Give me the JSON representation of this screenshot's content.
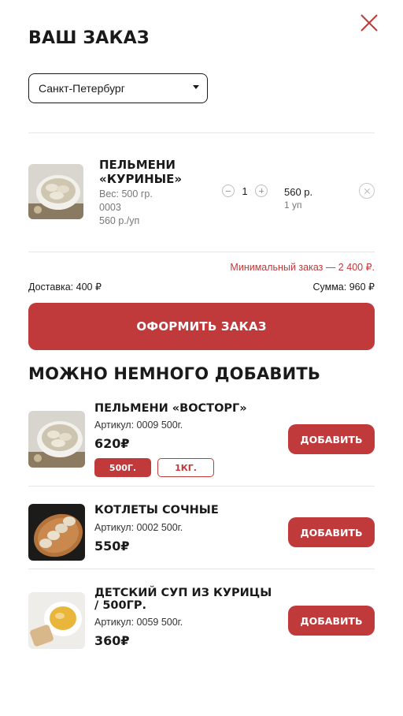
{
  "header": {
    "title": "ВАШ ЗАКАЗ",
    "close_icon": "close-icon",
    "accent_color": "#c0393b"
  },
  "city": {
    "selected": "Санкт-Петербург"
  },
  "cart": {
    "items": [
      {
        "name": "ПЕЛЬМЕНИ «КУРИНЫЕ»",
        "weight": "Вес: 500 гр.",
        "article": "0003",
        "unit_price": "560 р./уп",
        "quantity": "1",
        "price": "560 р.",
        "units": "1 уп"
      }
    ],
    "min_order": "Минимальный заказ — 2 400 ₽.",
    "delivery": "Доставка: 400 ₽",
    "sum": "Сумма: 960 ₽",
    "checkout_label": "ОФОРМИТЬ ЗАКАЗ"
  },
  "recommendations": {
    "title": "МОЖНО НЕМНОГО ДОБАВИТЬ",
    "add_label": "ДОБАВИТЬ",
    "items": [
      {
        "name": "ПЕЛЬМЕНИ «ВОСТОРГ»",
        "article": "Артикул: 0009  500г.",
        "price": "620₽",
        "weights": [
          "500Г.",
          "1КГ."
        ]
      },
      {
        "name": "КОТЛЕТЫ СОЧНЫЕ",
        "article": "Артикул: 0002  500г.",
        "price": "550₽"
      },
      {
        "name_line1": "ДЕТСКИЙ СУП ИЗ КУРИЦЫ",
        "name_line2": "/ 500ГР.",
        "article": "Артикул: 0059  500г.",
        "price": "360₽"
      }
    ]
  }
}
